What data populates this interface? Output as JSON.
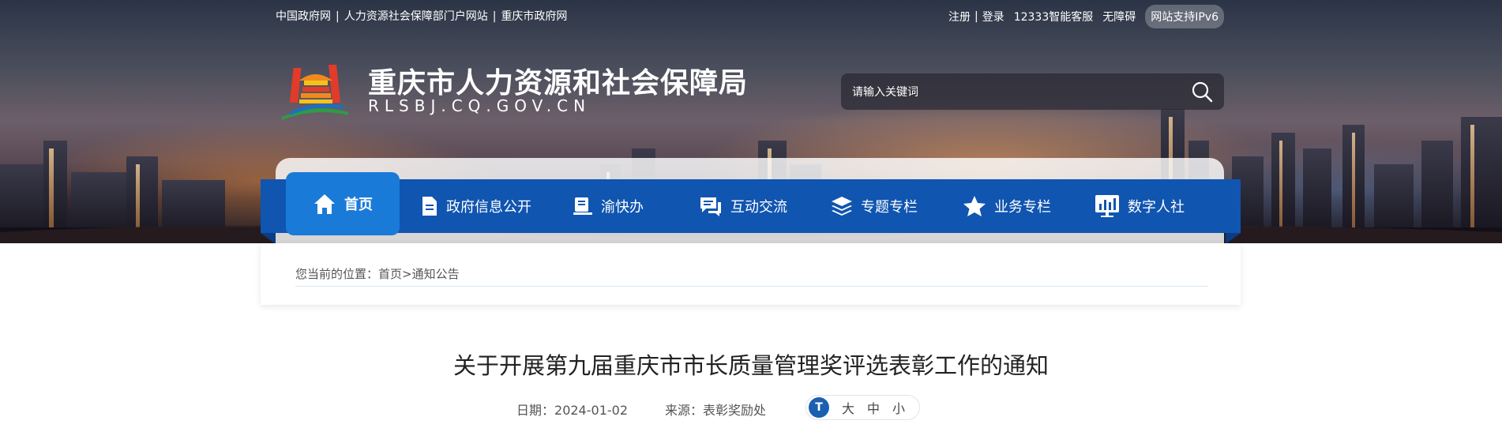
{
  "top_links": {
    "left": [
      "中国政府网",
      "人力资源社会保障部门户网站",
      "重庆市政府网"
    ],
    "separator": "|",
    "register": "注册",
    "login": "登录",
    "customer_service": "12333智能客服",
    "accessibility": "无障碍",
    "ipv6": "网站支持IPv6"
  },
  "header": {
    "title": "重庆市人力资源和社会保障局",
    "domain": "RLSBJ.CQ.GOV.CN",
    "search_placeholder": "请输入关键词"
  },
  "nav": {
    "items": [
      {
        "label": "首页",
        "icon": "home-icon",
        "active": true
      },
      {
        "label": "政府信息公开",
        "icon": "document-icon",
        "active": false
      },
      {
        "label": "渝快办",
        "icon": "book-icon",
        "active": false
      },
      {
        "label": "互动交流",
        "icon": "chat-icon",
        "active": false
      },
      {
        "label": "专题专栏",
        "icon": "layers-icon",
        "active": false
      },
      {
        "label": "业务专栏",
        "icon": "star-icon",
        "active": false
      },
      {
        "label": "数字人社",
        "icon": "chart-board-icon",
        "active": false
      }
    ]
  },
  "breadcrumb": {
    "prefix": "您当前的位置：",
    "home": "首页",
    "arrow": ">",
    "current": "通知公告"
  },
  "article": {
    "title": "关于开展第九届重庆市市长质量管理奖评选表彰工作的通知",
    "date_label": "日期：",
    "date": "2024-01-02",
    "source_label": "来源：",
    "source": "表彰奖励处",
    "font_size": {
      "icon_text": "T",
      "options": [
        "大",
        "中",
        "小"
      ]
    }
  },
  "colors": {
    "nav_blue": "#1055b0",
    "nav_active": "#1a7ad8",
    "title_text": "#222222"
  }
}
